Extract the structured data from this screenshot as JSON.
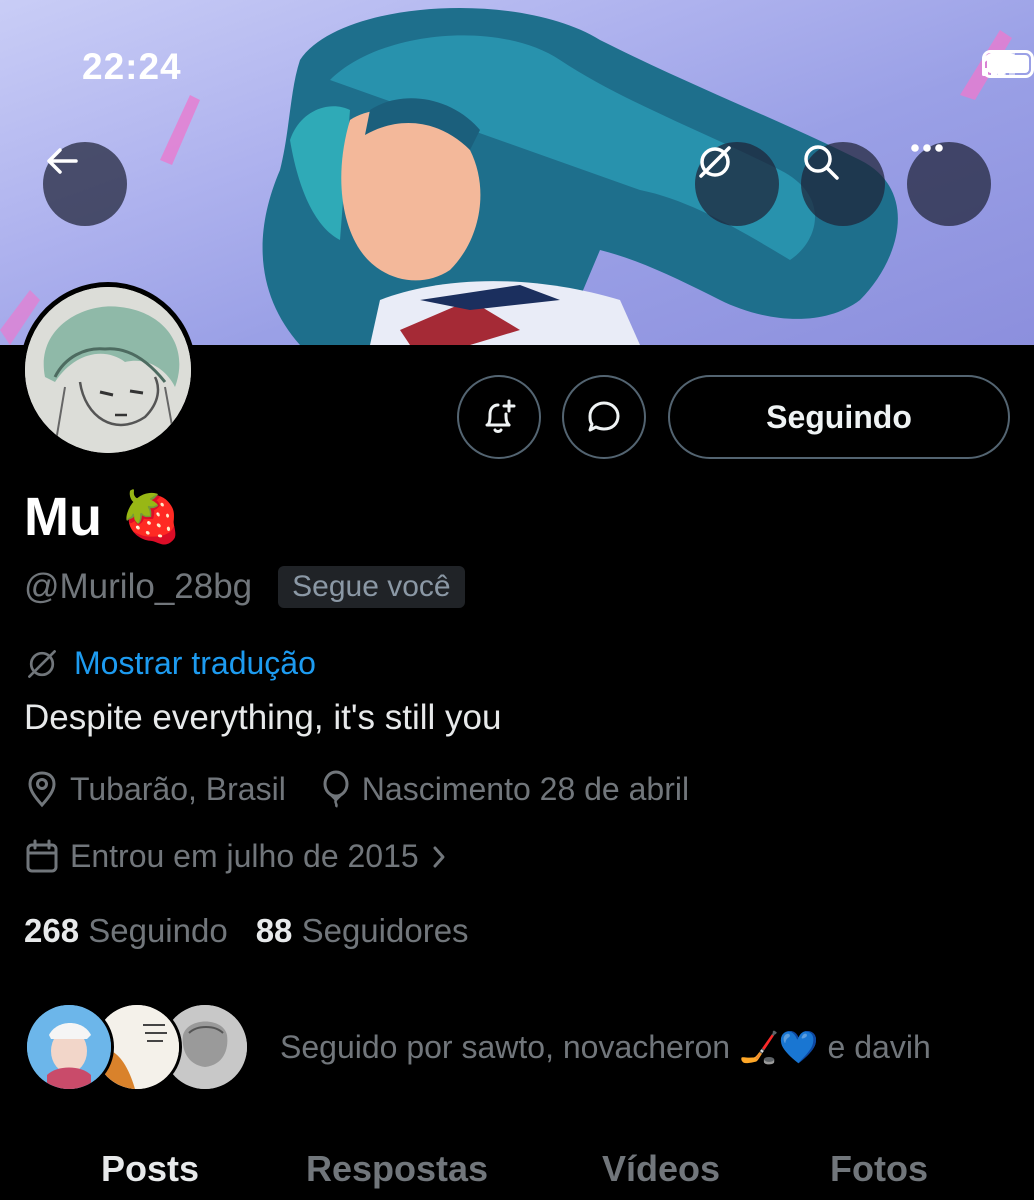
{
  "status_bar": {
    "time": "22:24"
  },
  "profile": {
    "name": "Mu",
    "name_emoji": "🍓",
    "handle": "@Murilo_28bg",
    "follows_you_badge": "Segue você",
    "translate_link": "Mostrar tradução",
    "bio": "Despite everything, it's still you",
    "location": "Tubarão, Brasil",
    "birthday": "Nascimento 28 de abril",
    "joined": "Entrou em julho de 2015",
    "following_count": "268",
    "following_label": "Seguindo",
    "followers_count": "88",
    "followers_label": "Seguidores",
    "followed_by": "Seguido por sawto, novacheron 🏒💙 e davih"
  },
  "actions": {
    "follow_state_label": "Seguindo"
  },
  "tabs": [
    {
      "label": "Posts",
      "active": true
    },
    {
      "label": "Respostas",
      "active": false
    },
    {
      "label": "Vídeos",
      "active": false
    },
    {
      "label": "Fotos",
      "active": false
    }
  ],
  "colors": {
    "accent": "#1d9bf0",
    "muted": "#71767b",
    "background": "#000000"
  }
}
